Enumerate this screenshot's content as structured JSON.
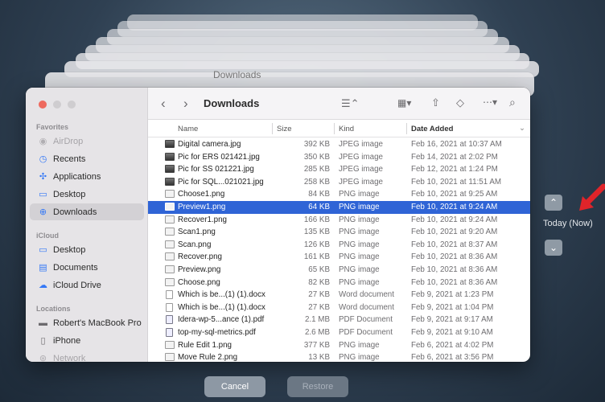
{
  "window": {
    "title": "Downloads"
  },
  "background": {
    "ghost_title": "Downloads"
  },
  "sidebar": {
    "favorites_label": "Favorites",
    "favorites": [
      {
        "label": "AirDrop",
        "icon": "airdrop-icon"
      },
      {
        "label": "Recents",
        "icon": "clock-icon"
      },
      {
        "label": "Applications",
        "icon": "applications-icon"
      },
      {
        "label": "Desktop",
        "icon": "desktop-icon"
      },
      {
        "label": "Downloads",
        "icon": "download-icon"
      }
    ],
    "icloud_label": "iCloud",
    "icloud": [
      {
        "label": "Desktop",
        "icon": "desktop-icon"
      },
      {
        "label": "Documents",
        "icon": "document-icon"
      },
      {
        "label": "iCloud Drive",
        "icon": "cloud-icon"
      }
    ],
    "locations_label": "Locations",
    "locations": [
      {
        "label": "Robert's MacBook Pro",
        "icon": "laptop-icon"
      },
      {
        "label": "iPhone",
        "icon": "phone-icon"
      },
      {
        "label": "Network",
        "icon": "globe-icon"
      }
    ]
  },
  "columns": {
    "name": "Name",
    "size": "Size",
    "kind": "Kind",
    "date": "Date Added"
  },
  "files": [
    {
      "name": "Digital camera.jpg",
      "size": "392 KB",
      "kind": "JPEG image",
      "date": "Feb 16, 2021 at 10:37 AM",
      "icon": "image"
    },
    {
      "name": "Pic for ERS 021421.jpg",
      "size": "350 KB",
      "kind": "JPEG image",
      "date": "Feb 14, 2021 at 2:02 PM",
      "icon": "image"
    },
    {
      "name": "Pic for SS 021221.jpg",
      "size": "285 KB",
      "kind": "JPEG image",
      "date": "Feb 12, 2021 at 1:24 PM",
      "icon": "image"
    },
    {
      "name": "Pic for SQL...021021.jpg",
      "size": "258 KB",
      "kind": "JPEG image",
      "date": "Feb 10, 2021 at 11:51 AM",
      "icon": "image"
    },
    {
      "name": "Choose1.png",
      "size": "84 KB",
      "kind": "PNG image",
      "date": "Feb 10, 2021 at 9:25 AM",
      "icon": "png"
    },
    {
      "name": "Preview1.png",
      "size": "64 KB",
      "kind": "PNG image",
      "date": "Feb 10, 2021 at 9:24 AM",
      "icon": "png",
      "selected": true
    },
    {
      "name": "Recover1.png",
      "size": "166 KB",
      "kind": "PNG image",
      "date": "Feb 10, 2021 at 9:24 AM",
      "icon": "png"
    },
    {
      "name": "Scan1.png",
      "size": "135 KB",
      "kind": "PNG image",
      "date": "Feb 10, 2021 at 9:20 AM",
      "icon": "png"
    },
    {
      "name": "Scan.png",
      "size": "126 KB",
      "kind": "PNG image",
      "date": "Feb 10, 2021 at 8:37 AM",
      "icon": "png"
    },
    {
      "name": "Recover.png",
      "size": "161 KB",
      "kind": "PNG image",
      "date": "Feb 10, 2021 at 8:36 AM",
      "icon": "png"
    },
    {
      "name": "Preview.png",
      "size": "65 KB",
      "kind": "PNG image",
      "date": "Feb 10, 2021 at 8:36 AM",
      "icon": "png"
    },
    {
      "name": "Choose.png",
      "size": "82 KB",
      "kind": "PNG image",
      "date": "Feb 10, 2021 at 8:36 AM",
      "icon": "png"
    },
    {
      "name": "Which is be...(1) (1).docx",
      "size": "27 KB",
      "kind": "Word document",
      "date": "Feb 9, 2021 at 1:23 PM",
      "icon": "doc"
    },
    {
      "name": "Which is be...(1) (1).docx",
      "size": "27 KB",
      "kind": "Word document",
      "date": "Feb 9, 2021 at 1:04 PM",
      "icon": "doc"
    },
    {
      "name": "Idera-wp-5...ance (1).pdf",
      "size": "2.1 MB",
      "kind": "PDF Document",
      "date": "Feb 9, 2021 at 9:17 AM",
      "icon": "pdf"
    },
    {
      "name": "top-my-sql-metrics.pdf",
      "size": "2.6 MB",
      "kind": "PDF Document",
      "date": "Feb 9, 2021 at 9:10 AM",
      "icon": "pdf"
    },
    {
      "name": "Rule Edit 1.png",
      "size": "377 KB",
      "kind": "PNG image",
      "date": "Feb 6, 2021 at 4:02 PM",
      "icon": "png"
    },
    {
      "name": "Move Rule 2.png",
      "size": "13 KB",
      "kind": "PNG image",
      "date": "Feb 6, 2021 at 3:56 PM",
      "icon": "png"
    }
  ],
  "timemachine": {
    "today_label": "Today (Now)"
  },
  "buttons": {
    "cancel": "Cancel",
    "restore": "Restore"
  },
  "colors": {
    "selection": "#2f64d6",
    "accent": "#3478f6",
    "arrow": "#e0242a"
  }
}
